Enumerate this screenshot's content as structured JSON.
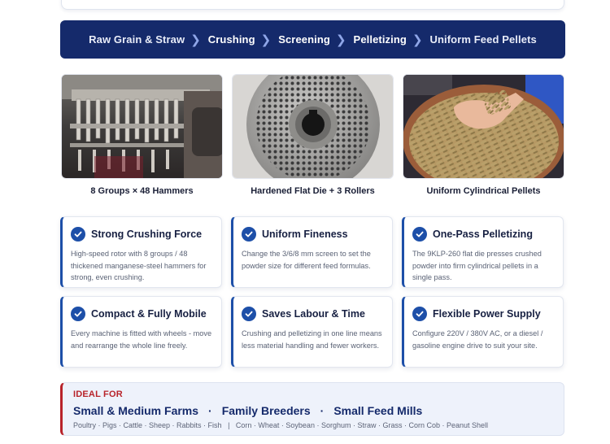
{
  "process": {
    "steps": [
      {
        "label": "Raw Grain & Straw"
      },
      {
        "label": "Crushing"
      },
      {
        "label": "Screening"
      },
      {
        "label": "Pelletizing"
      },
      {
        "label": "Uniform Feed Pellets"
      }
    ],
    "separator": "❯"
  },
  "gallery": [
    {
      "caption": "8 Groups × 48 Hammers"
    },
    {
      "caption": "Hardened Flat Die + 3 Rollers"
    },
    {
      "caption": "Uniform Cylindrical Pellets"
    }
  ],
  "features": [
    {
      "title": "Strong Crushing Force",
      "desc": "High-speed rotor with 8 groups / 48 thickened manganese-steel hammers for strong, even crushing."
    },
    {
      "title": "Uniform Fineness",
      "desc": "Change the 3/6/8 mm screen to set the powder size for different feed formulas."
    },
    {
      "title": "One-Pass Pelletizing",
      "desc": "The 9KLP-260 flat die presses crushed powder into firm cylindrical pellets in a single pass."
    },
    {
      "title": "Compact & Fully Mobile",
      "desc": "Every machine is fitted with wheels - move and rearrange the whole line freely."
    },
    {
      "title": "Saves Labour & Time",
      "desc": "Crushing and pelletizing in one line means less material handling and fewer workers."
    },
    {
      "title": "Flexible Power Supply",
      "desc": "Configure 220V / 380V AC, or a diesel / gasoline engine drive to suit your site."
    }
  ],
  "ideal": {
    "label": "IDEAL FOR",
    "targets": [
      "Small & Medium Farms",
      "Family Breeders",
      "Small Feed Mills"
    ],
    "separator": "·",
    "sub": "Poultry · Pigs · Cattle · Sheep · Rabbits · Fish   |   Corn · Wheat · Soybean · Sorghum · Straw · Grass · Corn Cob · Peanut Shell"
  },
  "colors": {
    "navy": "#152a6b",
    "accent_blue": "#1d4fa8",
    "accent_red": "#b8232a"
  }
}
